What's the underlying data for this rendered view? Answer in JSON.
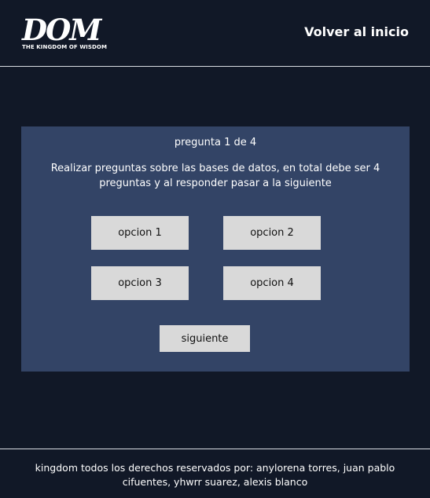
{
  "header": {
    "logo_mark": "DOM",
    "logo_tagline": "THE KINGDOM OF WISDOM",
    "home_link": "Volver al inicio"
  },
  "quiz": {
    "counter": "pregunta 1 de 4",
    "question": "Realizar preguntas sobre las bases de datos, en total debe ser 4 preguntas y al responder pasar a la siguiente",
    "options": [
      "opcion 1",
      "opcion 2",
      "opcion 3",
      "opcion 4"
    ],
    "next_label": "siguiente"
  },
  "footer": {
    "text": "kingdom todos los derechos reservados por: anylorena torres, juan pablo cifuentes, yhwrr suarez, alexis blanco"
  }
}
